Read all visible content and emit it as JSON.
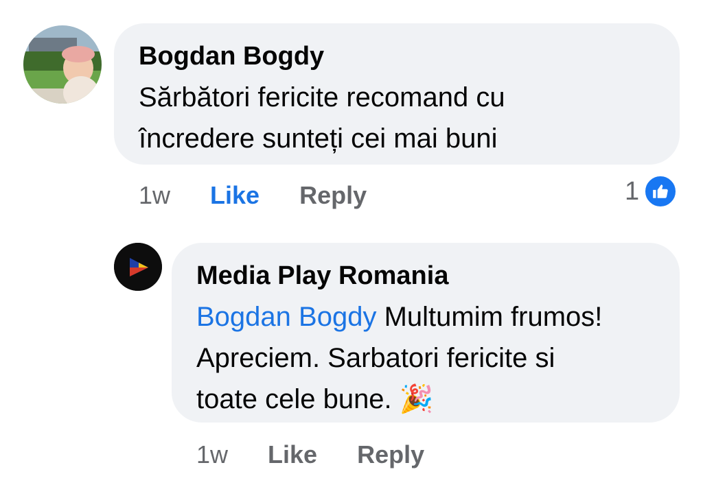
{
  "comment": {
    "author": "Bogdan Bogdy",
    "text": "Sărbători fericite recomand cu încredere sunteți cei mai buni",
    "time": "1w",
    "like_label": "Like",
    "reply_label": "Reply",
    "reaction_count": "1",
    "reaction_icon": "thumbs-up-icon",
    "like_state": "liked",
    "accent_color": "#1b74e4"
  },
  "reply": {
    "author": "Media Play Romania",
    "mention": "Bogdan Bogdy",
    "text": " Multumim frumos! Apreciem. Sarbatori fericite si toate cele bune. ",
    "emoji": "🎉",
    "time": "1w",
    "like_label": "Like",
    "reply_label": "Reply"
  }
}
